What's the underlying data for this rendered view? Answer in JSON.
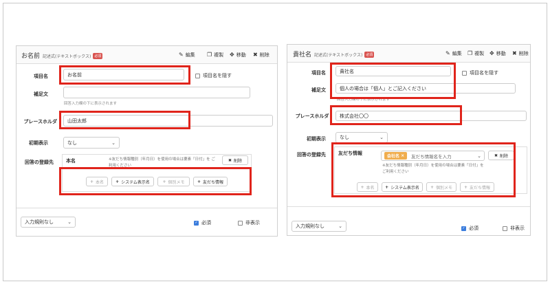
{
  "left": {
    "title": "お名前",
    "type_label": "記述式(テキストボックス)",
    "required_badge": "必須",
    "actions": {
      "edit": "編集",
      "copy": "複製",
      "move": "移動",
      "delete": "削除"
    },
    "labels": {
      "item_name": "項目名",
      "supplement": "補足文",
      "placeholder": "プレースホルダ",
      "initial": "初期表示",
      "register_to": "回答の登録先"
    },
    "item_name_value": "お名前",
    "hide_item_name": "項目名を隠す",
    "supplement_value": "",
    "supplement_hint": "回答入力欄の下に表示されます",
    "placeholder_value": "山田太郎",
    "initial_value": "なし",
    "register_target": "本名",
    "register_note": "※友だち情報種別（年月日）を使用の場合は要素「日付」を ご利用ください",
    "register_delete": "削除",
    "buttons": {
      "real_name": "本名",
      "system_name": "システム表示名",
      "memo": "個別メモ",
      "friend_info": "友だち情報"
    },
    "footer": {
      "rule": "入力規則なし",
      "required": "必須",
      "hidden": "非表示"
    }
  },
  "right": {
    "title": "貴社名",
    "type_label": "記述式(テキストボックス)",
    "required_badge": "必須",
    "actions": {
      "edit": "編集",
      "copy": "複製",
      "move": "移動",
      "delete": "削除"
    },
    "labels": {
      "item_name": "項目名",
      "supplement": "補足文",
      "placeholder": "プレースホルダ",
      "initial": "初期表示",
      "register_to": "回答の登録先"
    },
    "item_name_value": "貴社名",
    "hide_item_name": "項目名を隠す",
    "supplement_value": "個人の場合は「個人」とご記入ください",
    "supplement_hint": "回答入力欄の下に表示されます",
    "placeholder_value": "株式会社〇〇",
    "initial_value": "なし",
    "register_target": "友だち情報",
    "friend_tag": "会社名",
    "friend_select_placeholder": "友だち情報名を入力",
    "register_note": "※友だち情報種別（年月日）を使用の場合は要素「日付」を ご利用ください",
    "register_delete": "削除",
    "buttons": {
      "real_name": "本名",
      "system_name": "システム表示名",
      "memo": "個別メモ",
      "friend_info": "友だち情報"
    },
    "footer": {
      "rule": "入力規則なし",
      "required": "必須",
      "hidden": "非表示"
    }
  },
  "colors": {
    "highlight": "#e0241b",
    "badge": "#d9534f",
    "tag": "#f0ad4e",
    "checkbox": "#3b7ddd"
  },
  "icons": {
    "edit": "pencil-icon",
    "copy": "copy-icon",
    "move": "move-icon",
    "delete": "times-icon",
    "add": "plus-icon"
  }
}
